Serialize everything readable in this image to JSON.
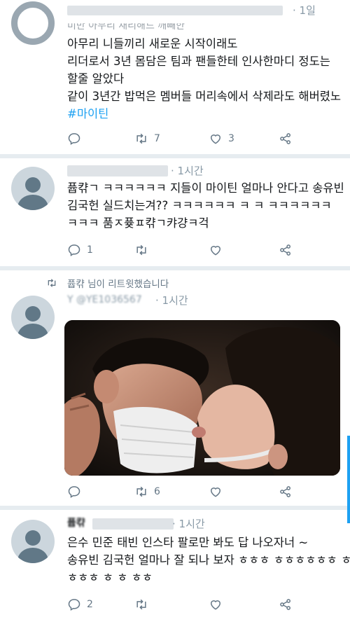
{
  "tweets": [
    {
      "time": "· 1일",
      "header_line": "미반 아무리 새리해드 깨빼한",
      "lines": [
        "아무리 니들끼리 새로운 시작이래도",
        "리더로서 3년 몸담은 팀과 팬들한테 인사한마디 정도는",
        "할줄 알았다",
        "같이 3년간 밥먹은 멤버들 머리속에서 삭제라도 해버렸노"
      ],
      "hashtag": "#마이틴",
      "retweets": "7",
      "likes": "3",
      "replies": ""
    },
    {
      "time": "· 1시간",
      "lines": [
        "퓹캮ㄱ ㅋㅋㅋㅋㅋㅋ 지들이 마이틴 얼마나 안다고 송유빈",
        "김국헌 실드치는겨?? ㅋㅋㅋㅋㅋㅋ ㅋ ㅋ ㅋㅋㅋㅋㅋㅋ",
        "ㅋㅋㅋ 품ㅈ퓾ㅍ캮ㄱ캬걍ㅋ걱"
      ],
      "replies": "1",
      "retweets": "",
      "likes": ""
    },
    {
      "retweet_label": "퓹캮 님이 리트윗했습니다",
      "handle_blur": "Y @YE1036567",
      "time": "· 1시간",
      "retweets": "6",
      "replies": "",
      "likes": ""
    },
    {
      "name_blur": "퓹캮",
      "time": "· 1시간",
      "lines": [
        "은수 민준 태빈 인스타 팔로만 봐도 답 나오자너 ~",
        "송유빈 김국헌 얼마나 잘 되나 보자 ㅎㅎㅎ ㅎㅎㅎㅎㅎㅎ ㅎ",
        "ㅎㅎㅎ ㅎ ㅎ ㅎㅎ"
      ],
      "replies": "2",
      "retweets": "",
      "likes": ""
    }
  ],
  "colors": {
    "accent": "#1da1f2",
    "text": "#14171a",
    "muted": "#657786",
    "separator": "#e6ecf0"
  },
  "icons": [
    "reply-icon",
    "retweet-icon",
    "heart-icon",
    "share-icon",
    "default-avatar-icon"
  ]
}
